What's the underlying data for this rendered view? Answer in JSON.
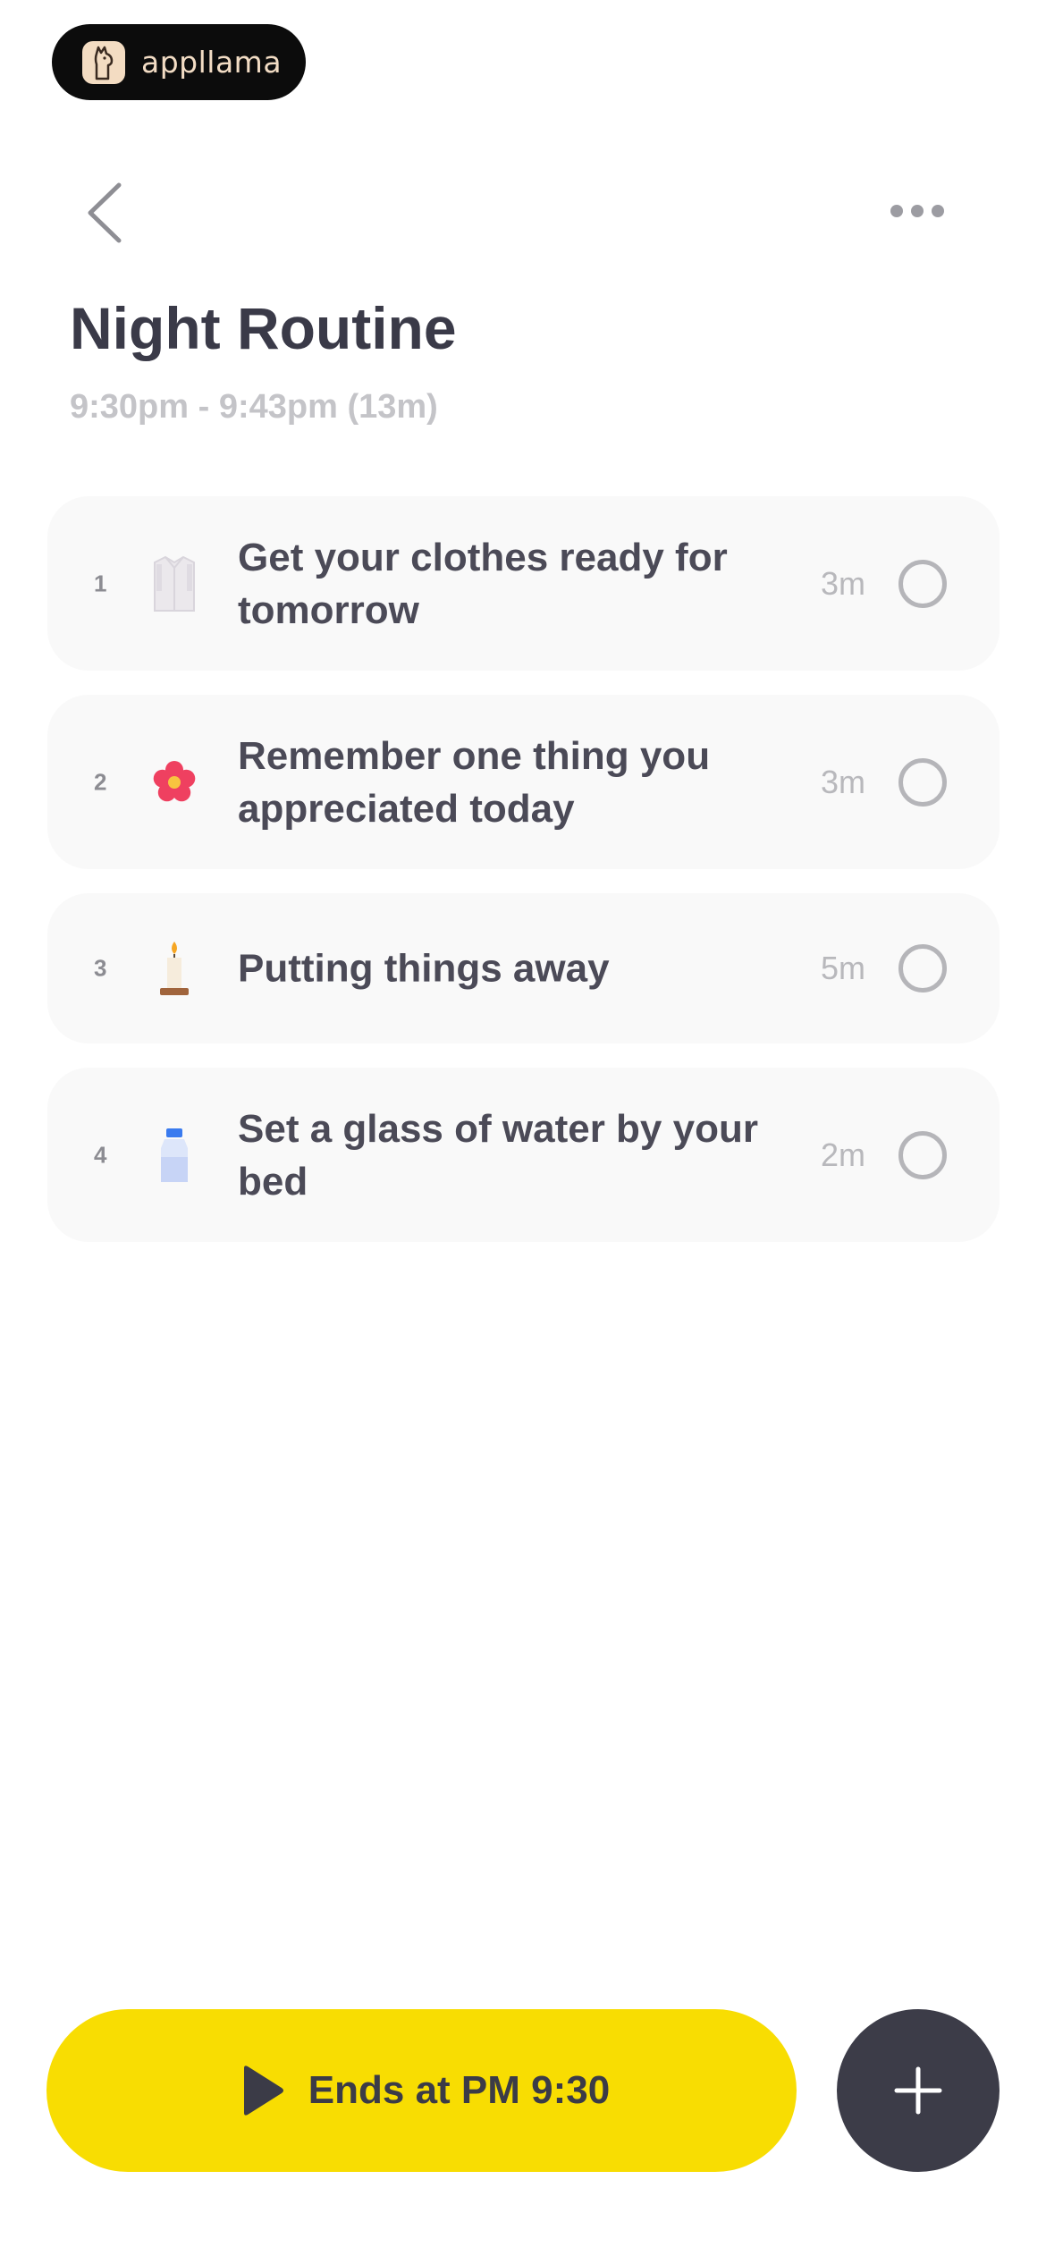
{
  "brand": {
    "name": "appllama",
    "icon": "llama-logo-icon"
  },
  "header": {
    "back_icon": "chevron-left-icon",
    "more_icon": "more-horizontal-icon"
  },
  "routine": {
    "title": "Night Routine",
    "time_range": "9:30pm - 9:43pm (13m)"
  },
  "tasks": [
    {
      "number": "1",
      "icon": "shirt-icon",
      "label": "Get your clothes ready for tomorrow",
      "duration": "3m",
      "completed": false
    },
    {
      "number": "2",
      "icon": "flower-icon",
      "label": "Remember one thing you appreciated today",
      "duration": "3m",
      "completed": false
    },
    {
      "number": "3",
      "icon": "candle-icon",
      "label": "Putting things away",
      "duration": "5m",
      "completed": false
    },
    {
      "number": "4",
      "icon": "water-bottle-icon",
      "label": "Set a glass of water by your bed",
      "duration": "2m",
      "completed": false
    }
  ],
  "footer": {
    "start_label": "Ends at PM 9:30",
    "start_icon": "play-icon",
    "add_icon": "plus-icon"
  },
  "colors": {
    "accent": "#f8dd02",
    "dark": "#3c3c48",
    "card": "#f9f9f9"
  }
}
